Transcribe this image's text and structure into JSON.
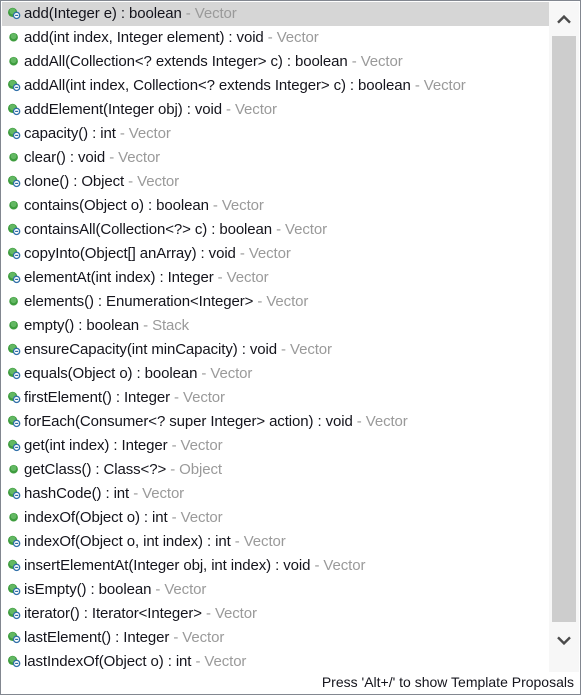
{
  "popup": {
    "kind": "content-assist-proposal-popup",
    "colors": {
      "selection": "#d6d6d6",
      "text": "#14141c",
      "declaring_type": "#9a9a9a",
      "icon_green": "#3e9c3e",
      "icon_overlay_blue": "#2f6fa8",
      "border": "#828790",
      "scrollbar_thumb": "#cdcdcd",
      "scrollbar_track": "#f7f7f7",
      "background": "#ffffff"
    }
  },
  "status_bar": {
    "message": "Press 'Alt+/' to show Template Proposals"
  },
  "scrollbar": {
    "up_arrow": "chevron-up-icon",
    "down_arrow": "chevron-down-icon",
    "orientation": "vertical"
  },
  "proposals": [
    {
      "icon": "method-public-overridden-icon",
      "signature": "add(Integer e) : boolean",
      "declarer": "Vector",
      "selected": true
    },
    {
      "icon": "method-public-icon",
      "signature": "add(int index, Integer element) : void",
      "declarer": "Vector",
      "selected": false
    },
    {
      "icon": "method-public-icon",
      "signature": "addAll(Collection<? extends Integer> c) : boolean",
      "declarer": "Vector",
      "selected": false
    },
    {
      "icon": "method-public-overridden-icon",
      "signature": "addAll(int index, Collection<? extends Integer> c) : boolean",
      "declarer": "Vector",
      "selected": false
    },
    {
      "icon": "method-public-overridden-icon",
      "signature": "addElement(Integer obj) : void",
      "declarer": "Vector",
      "selected": false
    },
    {
      "icon": "method-public-overridden-icon",
      "signature": "capacity() : int",
      "declarer": "Vector",
      "selected": false
    },
    {
      "icon": "method-public-icon",
      "signature": "clear() : void",
      "declarer": "Vector",
      "selected": false
    },
    {
      "icon": "method-public-overridden-icon",
      "signature": "clone() : Object",
      "declarer": "Vector",
      "selected": false
    },
    {
      "icon": "method-public-icon",
      "signature": "contains(Object o) : boolean",
      "declarer": "Vector",
      "selected": false
    },
    {
      "icon": "method-public-overridden-icon",
      "signature": "containsAll(Collection<?> c) : boolean",
      "declarer": "Vector",
      "selected": false
    },
    {
      "icon": "method-public-overridden-icon",
      "signature": "copyInto(Object[] anArray) : void",
      "declarer": "Vector",
      "selected": false
    },
    {
      "icon": "method-public-overridden-icon",
      "signature": "elementAt(int index) : Integer",
      "declarer": "Vector",
      "selected": false
    },
    {
      "icon": "method-public-icon",
      "signature": "elements() : Enumeration<Integer>",
      "declarer": "Vector",
      "selected": false
    },
    {
      "icon": "method-public-icon",
      "signature": "empty() : boolean",
      "declarer": "Stack",
      "selected": false
    },
    {
      "icon": "method-public-overridden-icon",
      "signature": "ensureCapacity(int minCapacity) : void",
      "declarer": "Vector",
      "selected": false
    },
    {
      "icon": "method-public-overridden-icon",
      "signature": "equals(Object o) : boolean",
      "declarer": "Vector",
      "selected": false
    },
    {
      "icon": "method-public-overridden-icon",
      "signature": "firstElement() : Integer",
      "declarer": "Vector",
      "selected": false
    },
    {
      "icon": "method-public-overridden-icon",
      "signature": "forEach(Consumer<? super Integer> action) : void",
      "declarer": "Vector",
      "selected": false
    },
    {
      "icon": "method-public-overridden-icon",
      "signature": "get(int index) : Integer",
      "declarer": "Vector",
      "selected": false
    },
    {
      "icon": "method-public-icon",
      "signature": "getClass() : Class<?>",
      "declarer": "Object",
      "selected": false
    },
    {
      "icon": "method-public-overridden-icon",
      "signature": "hashCode() : int",
      "declarer": "Vector",
      "selected": false
    },
    {
      "icon": "method-public-icon",
      "signature": "indexOf(Object o) : int",
      "declarer": "Vector",
      "selected": false
    },
    {
      "icon": "method-public-overridden-icon",
      "signature": "indexOf(Object o, int index) : int",
      "declarer": "Vector",
      "selected": false
    },
    {
      "icon": "method-public-overridden-icon",
      "signature": "insertElementAt(Integer obj, int index) : void",
      "declarer": "Vector",
      "selected": false
    },
    {
      "icon": "method-public-overridden-icon",
      "signature": "isEmpty() : boolean",
      "declarer": "Vector",
      "selected": false
    },
    {
      "icon": "method-public-overridden-icon",
      "signature": "iterator() : Iterator<Integer>",
      "declarer": "Vector",
      "selected": false
    },
    {
      "icon": "method-public-overridden-icon",
      "signature": "lastElement() : Integer",
      "declarer": "Vector",
      "selected": false
    },
    {
      "icon": "method-public-overridden-icon",
      "signature": "lastIndexOf(Object o) : int",
      "declarer": "Vector",
      "selected": false
    }
  ]
}
